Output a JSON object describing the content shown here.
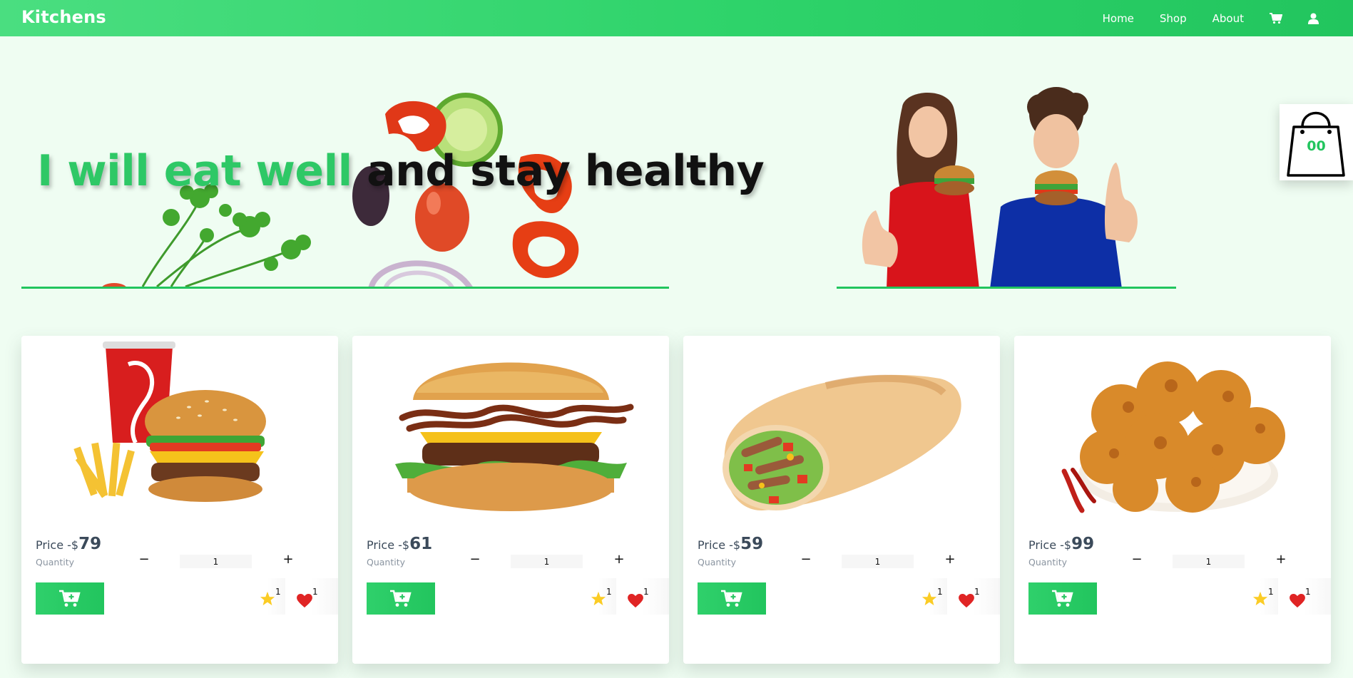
{
  "header": {
    "brand": "Kitchens",
    "nav": [
      "Home",
      "Shop",
      "About"
    ],
    "icons": [
      "cart-icon",
      "user-icon"
    ]
  },
  "hero": {
    "headline_part1": "I will eat well",
    "headline_part2": "and stay healthy"
  },
  "bag": {
    "count": "00"
  },
  "products": [
    {
      "name": "burger combo",
      "price_prefix": "Price -$",
      "price": "79",
      "quantity_label": "Quantity",
      "quantity": "1",
      "stars": "1",
      "likes": "1"
    },
    {
      "name": "bacon cheeseburger",
      "price_prefix": "Price -$",
      "price": "61",
      "quantity_label": "Quantity",
      "quantity": "1",
      "stars": "1",
      "likes": "1"
    },
    {
      "name": "shawarma wrap",
      "price_prefix": "Price -$",
      "price": "59",
      "quantity_label": "Quantity",
      "quantity": "1",
      "stars": "1",
      "likes": "1"
    },
    {
      "name": "fried chicken",
      "price_prefix": "Price -$",
      "price": "99",
      "quantity_label": "Quantity",
      "quantity": "1",
      "stars": "1",
      "likes": "1"
    }
  ],
  "colors": {
    "accent": "#22c55e",
    "background": "#effdf2",
    "star": "#fbcc25",
    "heart": "#e02424"
  }
}
